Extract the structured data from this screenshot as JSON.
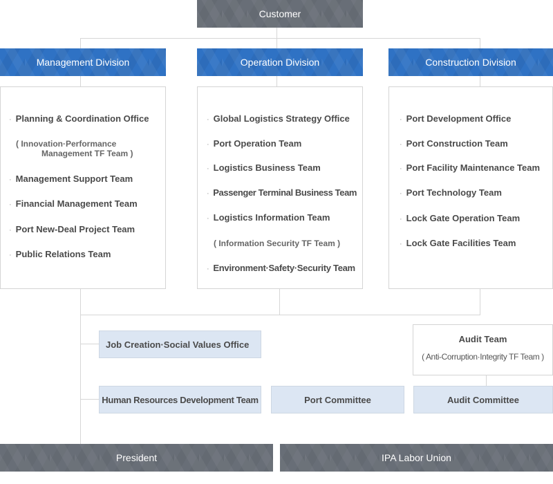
{
  "top": {
    "label": "Customer"
  },
  "divisions": [
    {
      "label": "Management Division",
      "items": [
        {
          "label": "Planning & Coordination Office"
        },
        {
          "sub": "( Innovation·Performance",
          "sub2": "Management TF Team )"
        },
        {
          "label": "Management Support Team"
        },
        {
          "label": "Financial Management Team"
        },
        {
          "label": "Port New-Deal Project Team"
        },
        {
          "label": "Public Relations Team"
        }
      ]
    },
    {
      "label": "Operation Division",
      "items": [
        {
          "label": "Global Logistics Strategy Office"
        },
        {
          "label": "Port Operation Team"
        },
        {
          "label": "Logistics Business Team"
        },
        {
          "label": "Passenger Terminal Business Team"
        },
        {
          "label": "Logistics Information Team"
        },
        {
          "sub": "( Information Security TF Team )"
        },
        {
          "label": "Environment·Safety·Security Team"
        }
      ]
    },
    {
      "label": "Construction Division",
      "items": [
        {
          "label": "Port Development Office"
        },
        {
          "label": "Port Construction Team"
        },
        {
          "label": "Port Facility Maintenance Team"
        },
        {
          "label": "Port Technology Team"
        },
        {
          "label": "Lock Gate Operation Team"
        },
        {
          "label": "Lock Gate Facilities Team"
        }
      ]
    }
  ],
  "staff": {
    "job_creation": "Job Creation·Social Values Office",
    "hr_development": "Human Resources Development Team",
    "port_committee": "Port Committee",
    "audit_committee": "Audit Committee",
    "audit_team": "Audit Team",
    "audit_team_sub": "( Anti-Corruption·Integrity TF Team )"
  },
  "bottom": {
    "president": "President",
    "labor_union": "IPA Labor Union"
  },
  "colors": {
    "division_blue": "#2f72c4",
    "header_gray": "#686e77",
    "staff_box": "#dce6f3",
    "connector": "#d6d6d6"
  },
  "bullet": "·"
}
